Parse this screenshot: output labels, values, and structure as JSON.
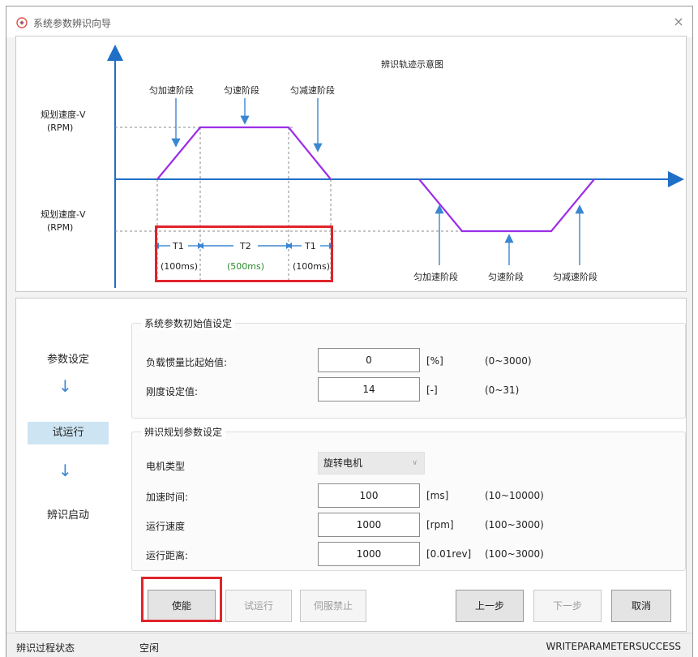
{
  "window": {
    "title": "系统参数辨识向导",
    "close_glyph": "×"
  },
  "diagram": {
    "title": "辨识轨迹示意图",
    "y_label_top_line1": "规划速度-V",
    "y_label_top_line2": "(RPM)",
    "y_label_bottom_line1": "规划速度-V",
    "y_label_bottom_line2": "(RPM)",
    "accel_label": "匀加速阶段",
    "const_label": "匀速阶段",
    "decel_label": "匀减速阶段",
    "accel_label_neg": "匀加速阶段",
    "const_label_neg": "匀速阶段",
    "decel_label_neg": "匀减速阶段",
    "t1_label": "T1",
    "t2_label": "T2",
    "t3_label": "T1",
    "t1_time": "(100ms)",
    "t2_time": "(500ms)",
    "t3_time": "(100ms)",
    "colors": {
      "axis": "#1f6fc7",
      "profile": "#9b2ee8",
      "arrow": "#3b86d1",
      "t2_time": "#2a8a2a",
      "highlight": "#e0242b"
    }
  },
  "steps": {
    "step1": "参数设定",
    "step2": "试运行",
    "step3": "辨识启动",
    "arrow_glyph": "↓"
  },
  "group1": {
    "title": "系统参数初始值设定",
    "rows": [
      {
        "label": "负载惯量比起始值:",
        "value": "0",
        "unit": "[%]",
        "range": "(0~3000)"
      },
      {
        "label": "刚度设定值:",
        "value": "14",
        "unit": "[-]",
        "range": "(0~31)"
      }
    ]
  },
  "group2": {
    "title": "辨识规划参数设定",
    "motor_type_label": "电机类型",
    "motor_type_value": "旋转电机",
    "rows": [
      {
        "label": "加速时间:",
        "value": "100",
        "unit": "[ms]",
        "range": "(10~10000)"
      },
      {
        "label": "运行速度",
        "value": "1000",
        "unit": "[rpm]",
        "range": "(100~3000)"
      },
      {
        "label": "运行距离:",
        "value": "1000",
        "unit": "[0.01rev]",
        "range": "(100~3000)"
      }
    ]
  },
  "buttons": {
    "enable": "使能",
    "trial_run": "试运行",
    "servo_off": "伺服禁止",
    "prev": "上一步",
    "next": "下一步",
    "cancel": "取消"
  },
  "status": {
    "label": "辨识过程状态",
    "state": "空闲",
    "message": "WRITEPARAMETERSUCCESS"
  }
}
